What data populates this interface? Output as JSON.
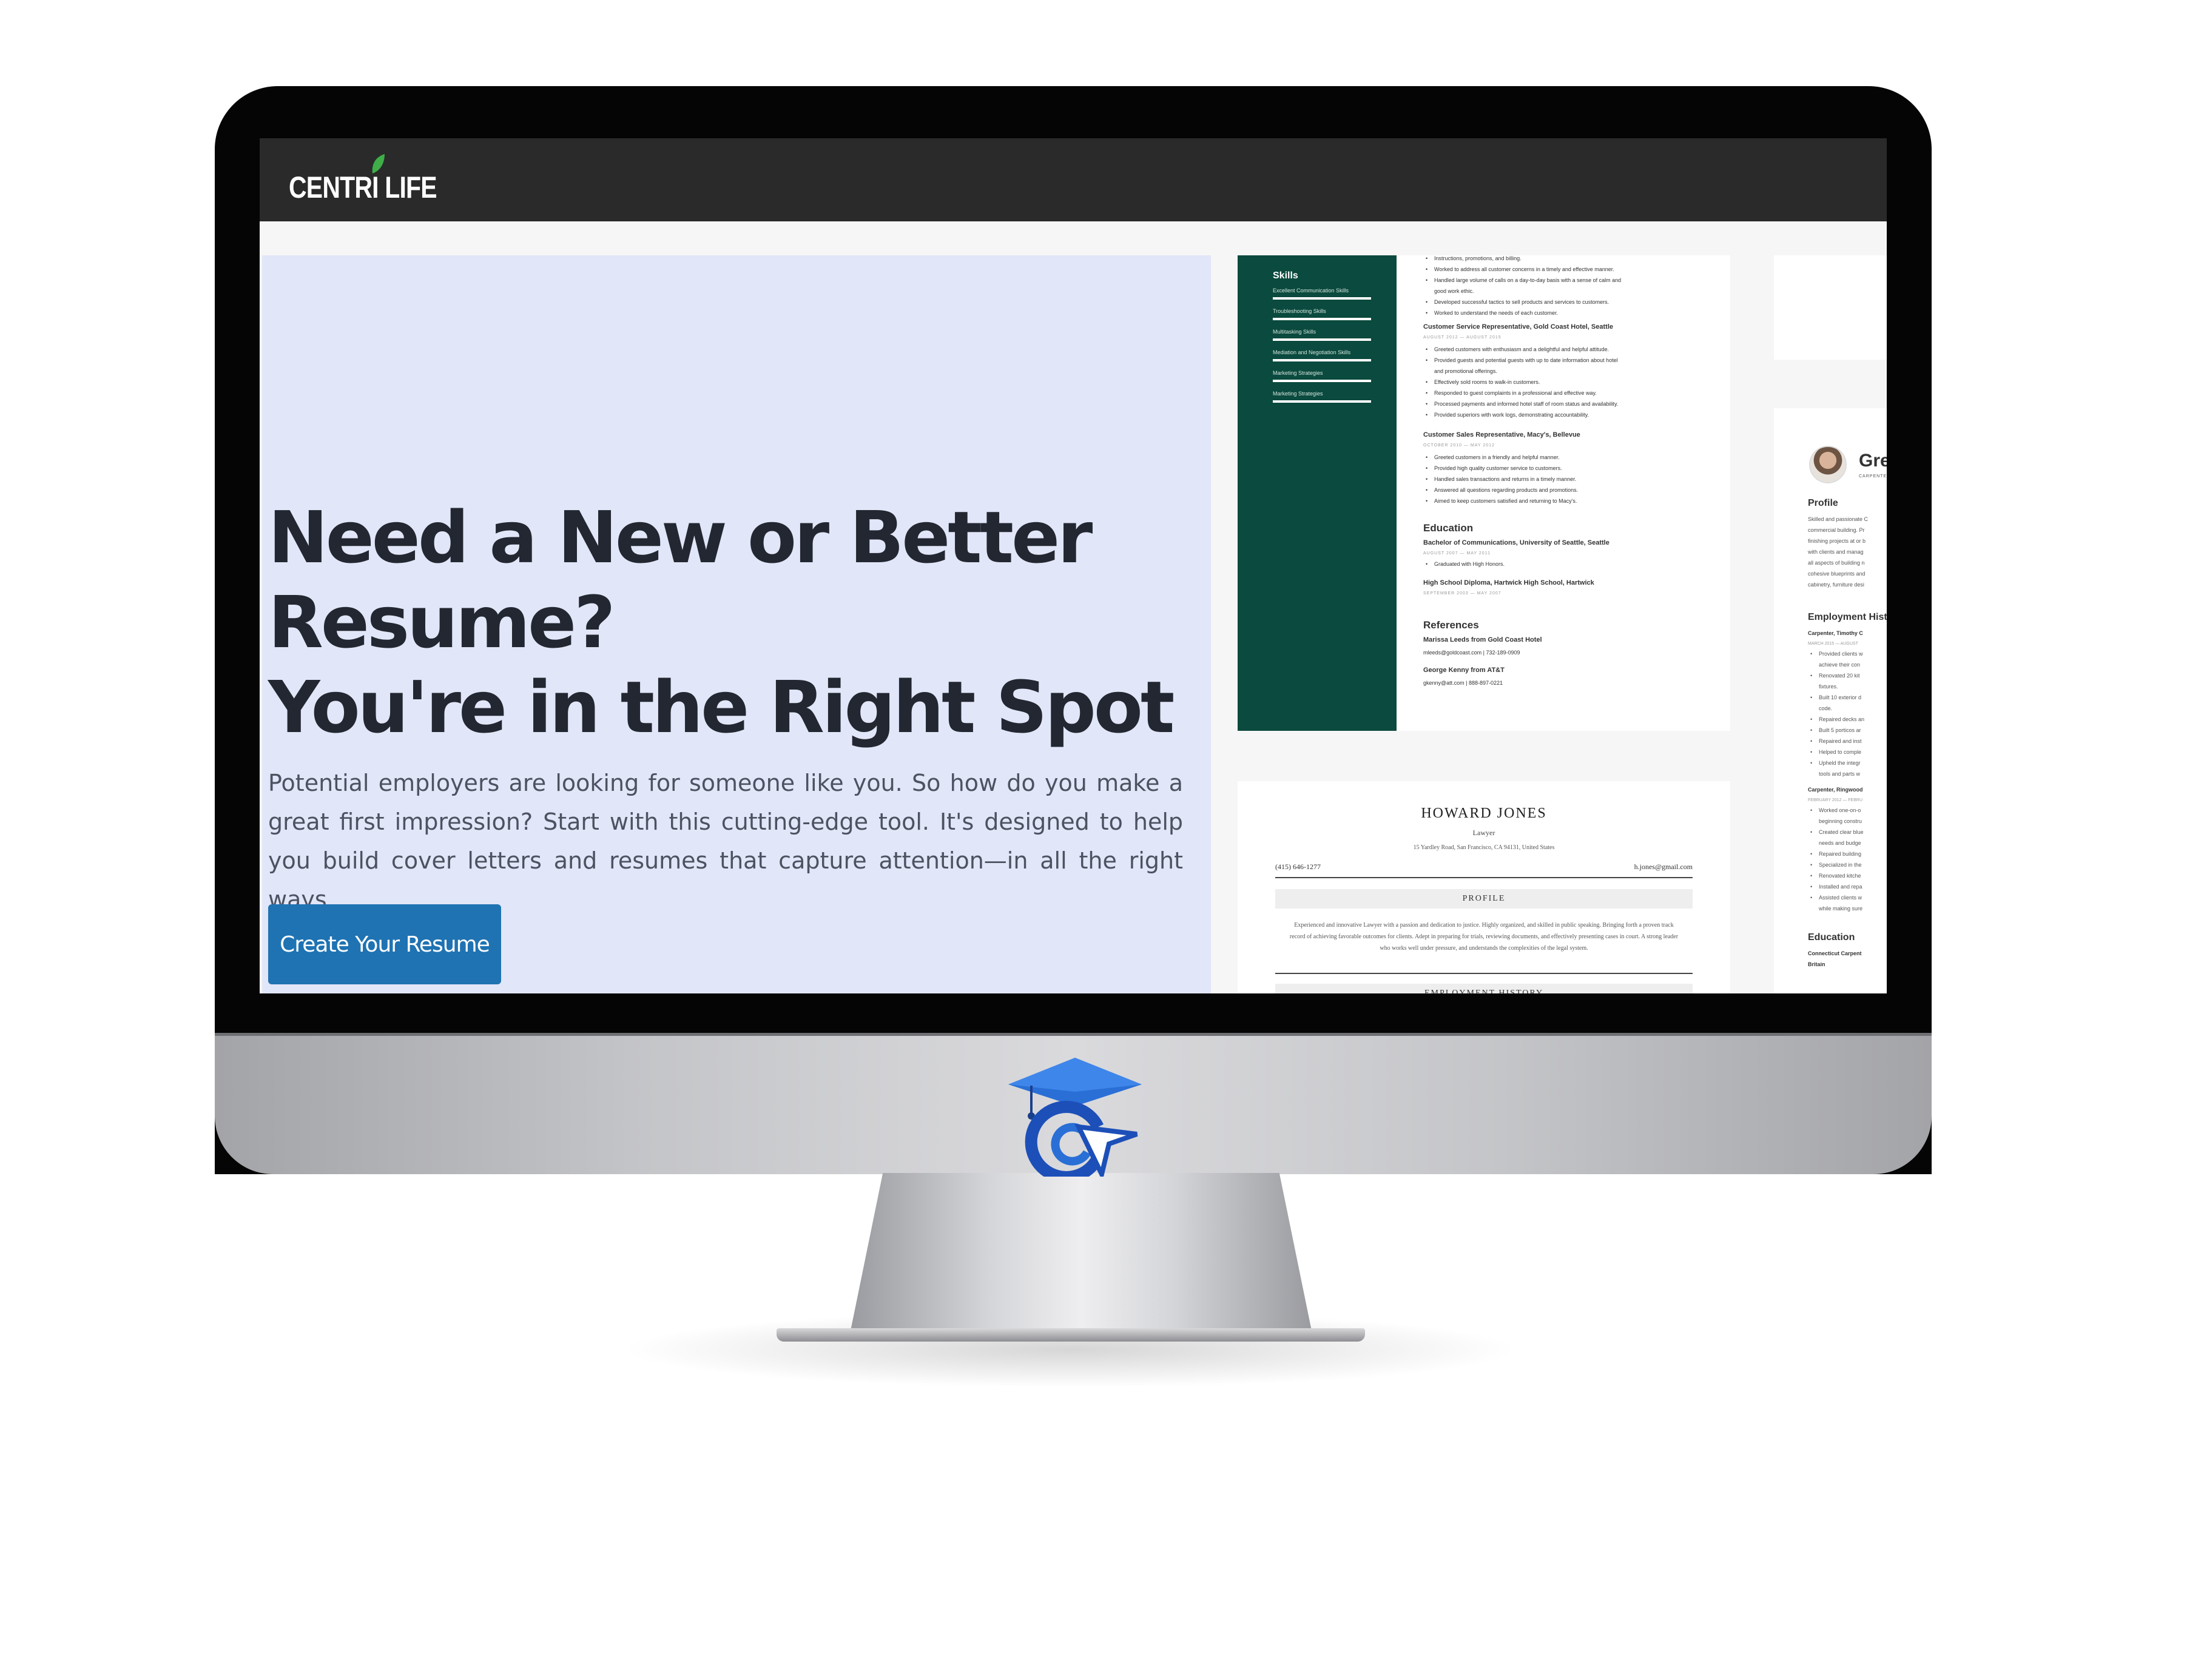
{
  "nav": {
    "logo": "CENTRI LIFE"
  },
  "hero": {
    "title_lines": [
      "Need a New or Better",
      "Resume?",
      "You're in the Right Spot"
    ],
    "body": "Potential employers are looking for someone like you. So how do you make a great first impression? Start with this cutting-edge tool. It's designed to help you build cover letters and resumes that capture attention—in all the right ways.",
    "cta_label": "Create Your Resume"
  },
  "resume_green": {
    "skills_heading": "Skills",
    "skills": [
      "Excellent Communication Skills",
      "Troubleshooting Skills",
      "Multitasking Skills",
      "Mediation and Negotiation Skills",
      "Marketing Strategies",
      "Marketing Strategies"
    ],
    "top_bullets": [
      "Instructions, promotions, and billing.",
      "Worked to address all customer concerns in a timely and effective manner.",
      "Handled large volume of calls on a day-to-day basis with a sense of calm and",
      "good work ethic.",
      "Developed successful tactics to sell products and services to customers.",
      "Worked to understand the needs of each customer."
    ],
    "job2_title": "Customer Service Representative, Gold Coast Hotel, Seattle",
    "job2_dates": "AUGUST 2012 — AUGUST 2015",
    "job2_bullets": [
      "Greeted customers with enthusiasm and a delightful and helpful attitude.",
      "Provided guests and potential guests with up to date information about hotel",
      "and promotional offerings.",
      "Effectively sold rooms to walk-in customers.",
      "Responded to guest complaints in a professional and effective way.",
      "Processed payments and informed hotel staff of room status and availability.",
      "Provided superiors with work logs, demonstrating accountability."
    ],
    "job3_title": "Customer Sales Representative, Macy's, Bellevue",
    "job3_dates": "OCTOBER 2010 — MAY 2012",
    "job3_bullets": [
      "Greeted customers in a friendly and helpful manner.",
      "Provided high quality customer service to customers.",
      "Handled sales transactions and returns in a timely manner.",
      "Answered all questions regarding products and promotions.",
      "Aimed to keep customers satisfied and returning to Macy's."
    ],
    "education_heading": "Education",
    "edu1": "Bachelor of Communications, University of Seattle, Seattle",
    "edu1_dates": "AUGUST 2007 — MAY 2011",
    "edu1_note": "Graduated with High Honors.",
    "edu2": "High School Diploma, Hartwick High School, Hartwick",
    "edu2_dates": "SEPTEMBER 2003 — MAY 2007",
    "references_heading": "References",
    "ref1": "Marissa Leeds from Gold Coast Hotel",
    "ref1_contact": "mleeds@goldcoast.com | 732-189-0909",
    "ref2": "George Kenny from AT&T",
    "ref2_contact": "gkenny@att.com | 888-897-0221"
  },
  "resume_howard": {
    "name": "HOWARD JONES",
    "role": "Lawyer",
    "address": "15 Yardley Road, San Francisco, CA 94131, United States",
    "phone": "(415) 646-1277",
    "email": "h.jones@gmail.com",
    "profile_heading": "PROFILE",
    "profile_text": "Experienced and innovative Lawyer with a passion and dedication to justice. Highly organized, and skilled in public speaking. Bringing forth a proven track record of achieving favorable outcomes for clients. Adept in preparing for trials, reviewing documents, and effectively presenting cases in court. A strong leader who works well under pressure, and understands the complexities of the legal system.",
    "next_heading": "EMPLOYMENT HISTORY"
  },
  "resume_greg": {
    "name": "Greg",
    "subtitle": "CARPENTER",
    "profile_heading": "Profile",
    "profile_lines": [
      "Skilled and passionate C",
      "commercial building. Pr",
      "finishing projects at or b",
      "with clients and manag",
      "all aspects of building n",
      "cohesive blueprints and",
      "cabinetry, furniture desi"
    ],
    "employment_heading": "Employment Histo",
    "job1": "Carpenter, Timothy C",
    "job1_dates": "MARCH 2015 — AUGUST",
    "job1_bullets": [
      "Provided clients w",
      "achieve their con",
      "Renovated 20 kit",
      "fixtures.",
      "Built 10 exterior d",
      "code.",
      "Repaired decks an",
      "Built 5 porticos ar",
      "Repaired and inst",
      "Helped to comple",
      "Upheld the integr",
      "tools and parts w"
    ],
    "job2": "Carpenter, Ringwood",
    "job2_dates": "FEBRUARY 2012 — FEBRU",
    "job2_bullets": [
      "Worked one-on-o",
      "beginning constru",
      "Created clear blue",
      "needs and budge",
      "Repaired building",
      "Specialized in the",
      "Renovated kitche",
      "Installed and repa",
      "Assisted clients w",
      "while making sure"
    ],
    "education_heading": "Education",
    "edu_lines": [
      "Connecticut Carpent",
      "Britain"
    ]
  }
}
